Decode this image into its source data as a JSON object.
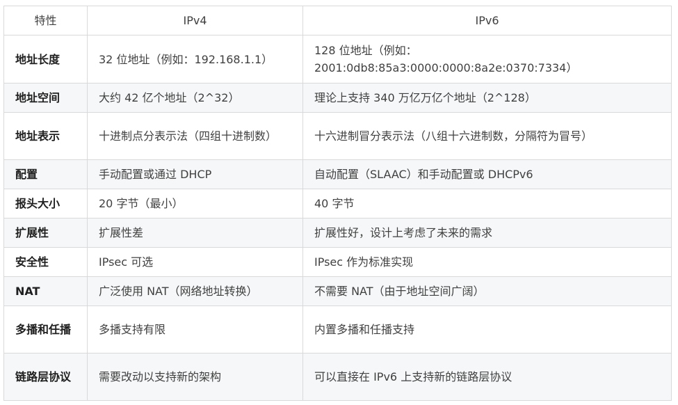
{
  "table": {
    "headers": [
      "特性",
      "IPv4",
      "IPv6"
    ],
    "rows": [
      [
        "地址长度",
        "32 位地址（例如：192.168.1.1）",
        "128 位地址（例如：2001:0db8:85a3:0000:0000:8a2e:0370:7334）"
      ],
      [
        "地址空间",
        "大约 42 亿个地址（2^32）",
        "理论上支持 340 万亿万亿个地址（2^128）"
      ],
      [
        "地址表示",
        "十进制点分表示法（四组十进制数）",
        "十六进制冒分表示法（八组十六进制数，分隔符为冒号）"
      ],
      [
        "配置",
        "手动配置或通过 DHCP",
        "自动配置（SLAAC）和手动配置或 DHCPv6"
      ],
      [
        "报头大小",
        "20 字节（最小）",
        "40 字节"
      ],
      [
        "扩展性",
        "扩展性差",
        "扩展性好，设计上考虑了未来的需求"
      ],
      [
        "安全性",
        "IPsec 可选",
        "IPsec 作为标准实现"
      ],
      [
        "NAT",
        "广泛使用 NAT（网络地址转换）",
        "不需要 NAT（由于地址空间广阔）"
      ],
      [
        "多播和任播",
        "多播支持有限",
        "内置多播和任播支持"
      ],
      [
        "链路层协议",
        "需要改动以支持新的架构",
        "可以直接在 IPv6 上支持新的链路层协议"
      ]
    ]
  }
}
